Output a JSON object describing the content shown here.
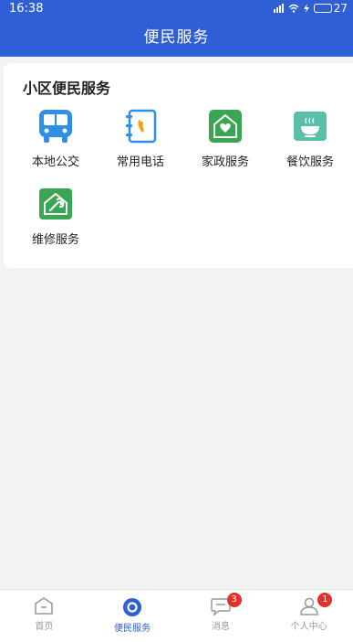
{
  "status_bar": {
    "time": "16:38",
    "battery": "27",
    "battery_level": 0.27
  },
  "header": {
    "title": "便民服务"
  },
  "section": {
    "title": "小区便民服务",
    "services": [
      {
        "label": "本地公交",
        "icon": "bus-icon",
        "color": "#2f8fe6"
      },
      {
        "label": "常用电话",
        "icon": "phonebook-icon",
        "color": "#2f8fe6"
      },
      {
        "label": "家政服务",
        "icon": "home-heart-icon",
        "color": "#3aa653"
      },
      {
        "label": "餐饮服务",
        "icon": "bowl-icon",
        "color": "#5bbfa7"
      },
      {
        "label": "维修服务",
        "icon": "repair-icon",
        "color": "#3aa653"
      }
    ]
  },
  "tabbar": {
    "tabs": [
      {
        "label": "首页",
        "icon": "home-icon",
        "active": false
      },
      {
        "label": "便民服务",
        "icon": "service-icon",
        "active": true
      },
      {
        "label": "消息",
        "icon": "message-icon",
        "active": false,
        "badge": "3"
      },
      {
        "label": "个人中心",
        "icon": "profile-icon",
        "active": false,
        "badge": "1"
      }
    ]
  },
  "colors": {
    "primary": "#2f5fd5",
    "badge": "#e8302a"
  }
}
